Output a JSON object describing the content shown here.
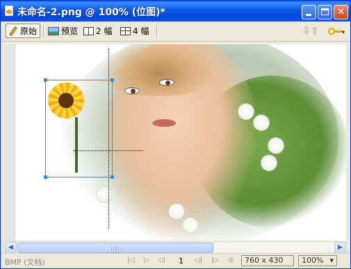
{
  "window": {
    "title": "未命名-2.png @ 100% (位图)*",
    "minimize_label": "",
    "maximize_label": "",
    "close_glyph": "✕"
  },
  "toolbar": {
    "original_label": "原始",
    "preview_label": "预览",
    "two_up_label": "2 幅",
    "four_up_label": "4 幅",
    "export_arrows_glyph": "⇩⇧",
    "key_icon": "quick-export-icon"
  },
  "status": {
    "format_label": "BMP (文档)",
    "frame_number": "1",
    "dimensions": "760 x 430",
    "zoom": "100%",
    "zoom_arrow": "▾"
  },
  "scrollbar": {
    "left_arrow": "◀",
    "right_arrow": "▶"
  },
  "navigation": {
    "first_glyph": "|◁",
    "play_glyph": "▷",
    "prev_glyph": "◁|",
    "next_glyph": "|▷",
    "loop_glyph": "◎"
  },
  "colors": {
    "title_bar": "#0c58e5",
    "selection": "#1e90ff",
    "window_face": "#ece9d8"
  }
}
